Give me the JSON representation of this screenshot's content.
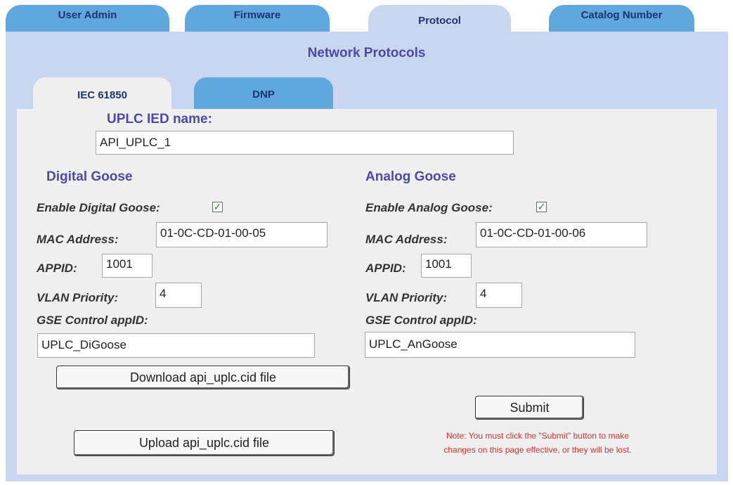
{
  "tabs": [
    "User Admin",
    "Firmware",
    "Protocol",
    "Catalog Number"
  ],
  "section_title": "Network Protocols",
  "subtabs": [
    "IEC 61850",
    "DNP"
  ],
  "ied": {
    "label": "UPLC IED name:",
    "value": "API_UPLC_1"
  },
  "digital": {
    "heading": "Digital Goose",
    "enable_label": "Enable Digital Goose:",
    "enabled": true,
    "mac_label": "MAC Address:",
    "mac_value": "01-0C-CD-01-00-05",
    "appid_label": "APPID:",
    "appid_value": "1001",
    "vlan_label": "VLAN Priority:",
    "vlan_value": "4",
    "gse_label": "GSE Control appID:",
    "gse_value": "UPLC_DiGoose"
  },
  "analog": {
    "heading": "Analog Goose",
    "enable_label": "Enable Analog Goose:",
    "enabled": true,
    "mac_label": "MAC Address:",
    "mac_value": "01-0C-CD-01-00-06",
    "appid_label": "APPID:",
    "appid_value": "1001",
    "vlan_label": "VLAN Priority:",
    "vlan_value": "4",
    "gse_label": "GSE Control appID:",
    "gse_value": "UPLC_AnGoose"
  },
  "buttons": {
    "download": "Download api_uplc.cid file",
    "upload": "Upload api_uplc.cid file",
    "submit": "Submit"
  },
  "note_line1": "Note: You must click the \"Submit\" button to make",
  "note_line2": "changes on this page effective, or they will be lost.",
  "colors": {
    "tab": "#5fa7dd",
    "active_tab": "#c9d6ef",
    "panel": "#efefef",
    "heading": "#4c4aa6",
    "note": "#d5322d"
  }
}
